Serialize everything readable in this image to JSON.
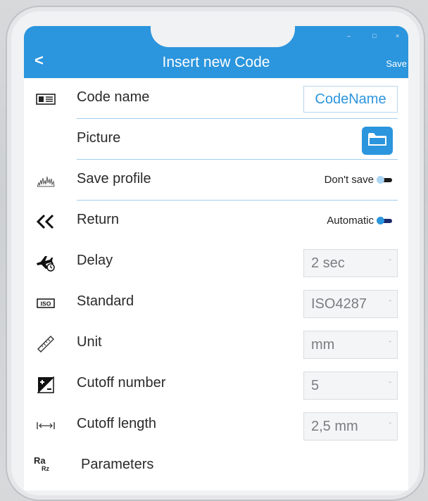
{
  "window": {
    "title": "Insert new Code",
    "back_label": "<",
    "save_label": "Save",
    "minimize": "–",
    "maximize": "□",
    "close": "×"
  },
  "colors": {
    "accent": "#2b95dd",
    "divider": "#9fcdee"
  },
  "rows": {
    "code_name": {
      "label": "Code name",
      "value": "CodeName",
      "icon": "id-card-icon"
    },
    "picture": {
      "label": "Picture",
      "icon": "folder-icon"
    },
    "save_profile": {
      "label": "Save profile",
      "toggle_text": "Don't save",
      "toggle_on": false,
      "icon": "profile-graph-icon"
    },
    "return": {
      "label": "Return",
      "toggle_text": "Automatic",
      "toggle_on": true,
      "icon": "double-chevron-left-icon"
    },
    "delay": {
      "label": "Delay",
      "value": "2 sec",
      "icon": "plane-timer-icon"
    },
    "standard": {
      "label": "Standard",
      "value": "ISO4287",
      "icon": "iso-icon"
    },
    "unit": {
      "label": "Unit",
      "value": "mm",
      "icon": "ruler-icon"
    },
    "cutoff_number": {
      "label": "Cutoff number",
      "value": "5",
      "icon": "plus-minus-icon"
    },
    "cutoff_length": {
      "label": "Cutoff length",
      "value": "2,5 mm",
      "icon": "length-icon"
    },
    "parameters": {
      "label": "Parameters",
      "icon_top": "Ra",
      "icon_bottom": "Rz"
    }
  }
}
